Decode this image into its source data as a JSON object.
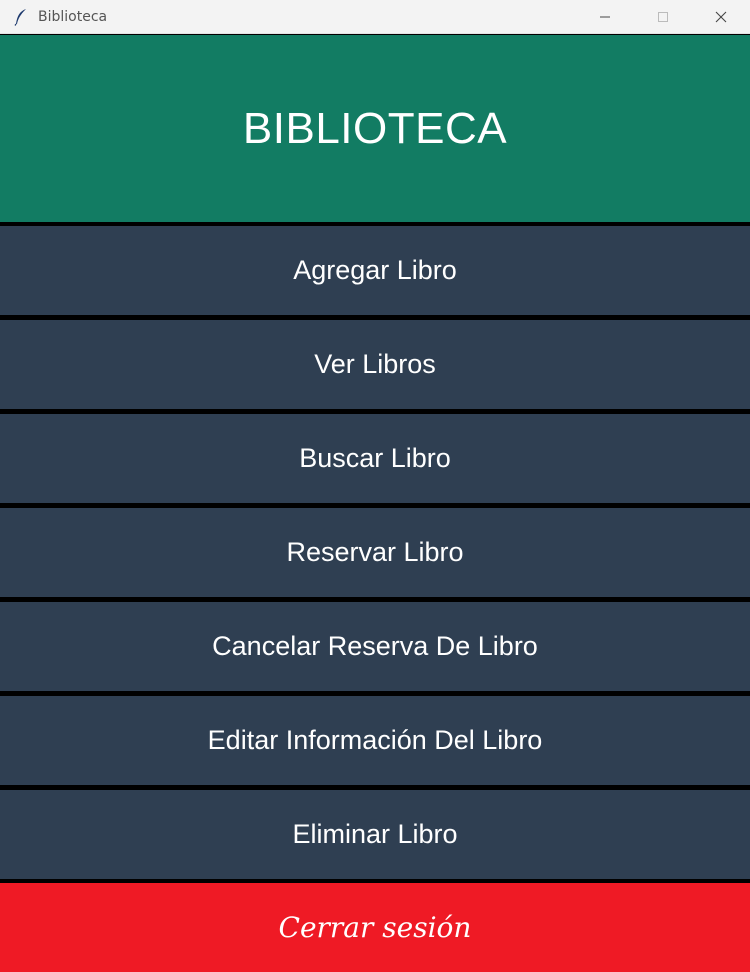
{
  "window": {
    "title": "Biblioteca",
    "app_icon": "feather-icon",
    "controls": [
      "minimize-icon",
      "maximize-icon",
      "close-icon"
    ]
  },
  "header": {
    "title": "BIBLIOTECA",
    "color": "#127c63"
  },
  "menu": {
    "button_color": "#2f3f52",
    "items": [
      {
        "label": "Agregar Libro"
      },
      {
        "label": "Ver Libros"
      },
      {
        "label": "Buscar Libro"
      },
      {
        "label": "Reservar Libro"
      },
      {
        "label": "Cancelar Reserva De Libro"
      },
      {
        "label": "Editar Información Del Libro"
      },
      {
        "label": "Eliminar Libro"
      }
    ]
  },
  "logout": {
    "label": "Cerrar sesión",
    "color": "#ef1a25"
  }
}
